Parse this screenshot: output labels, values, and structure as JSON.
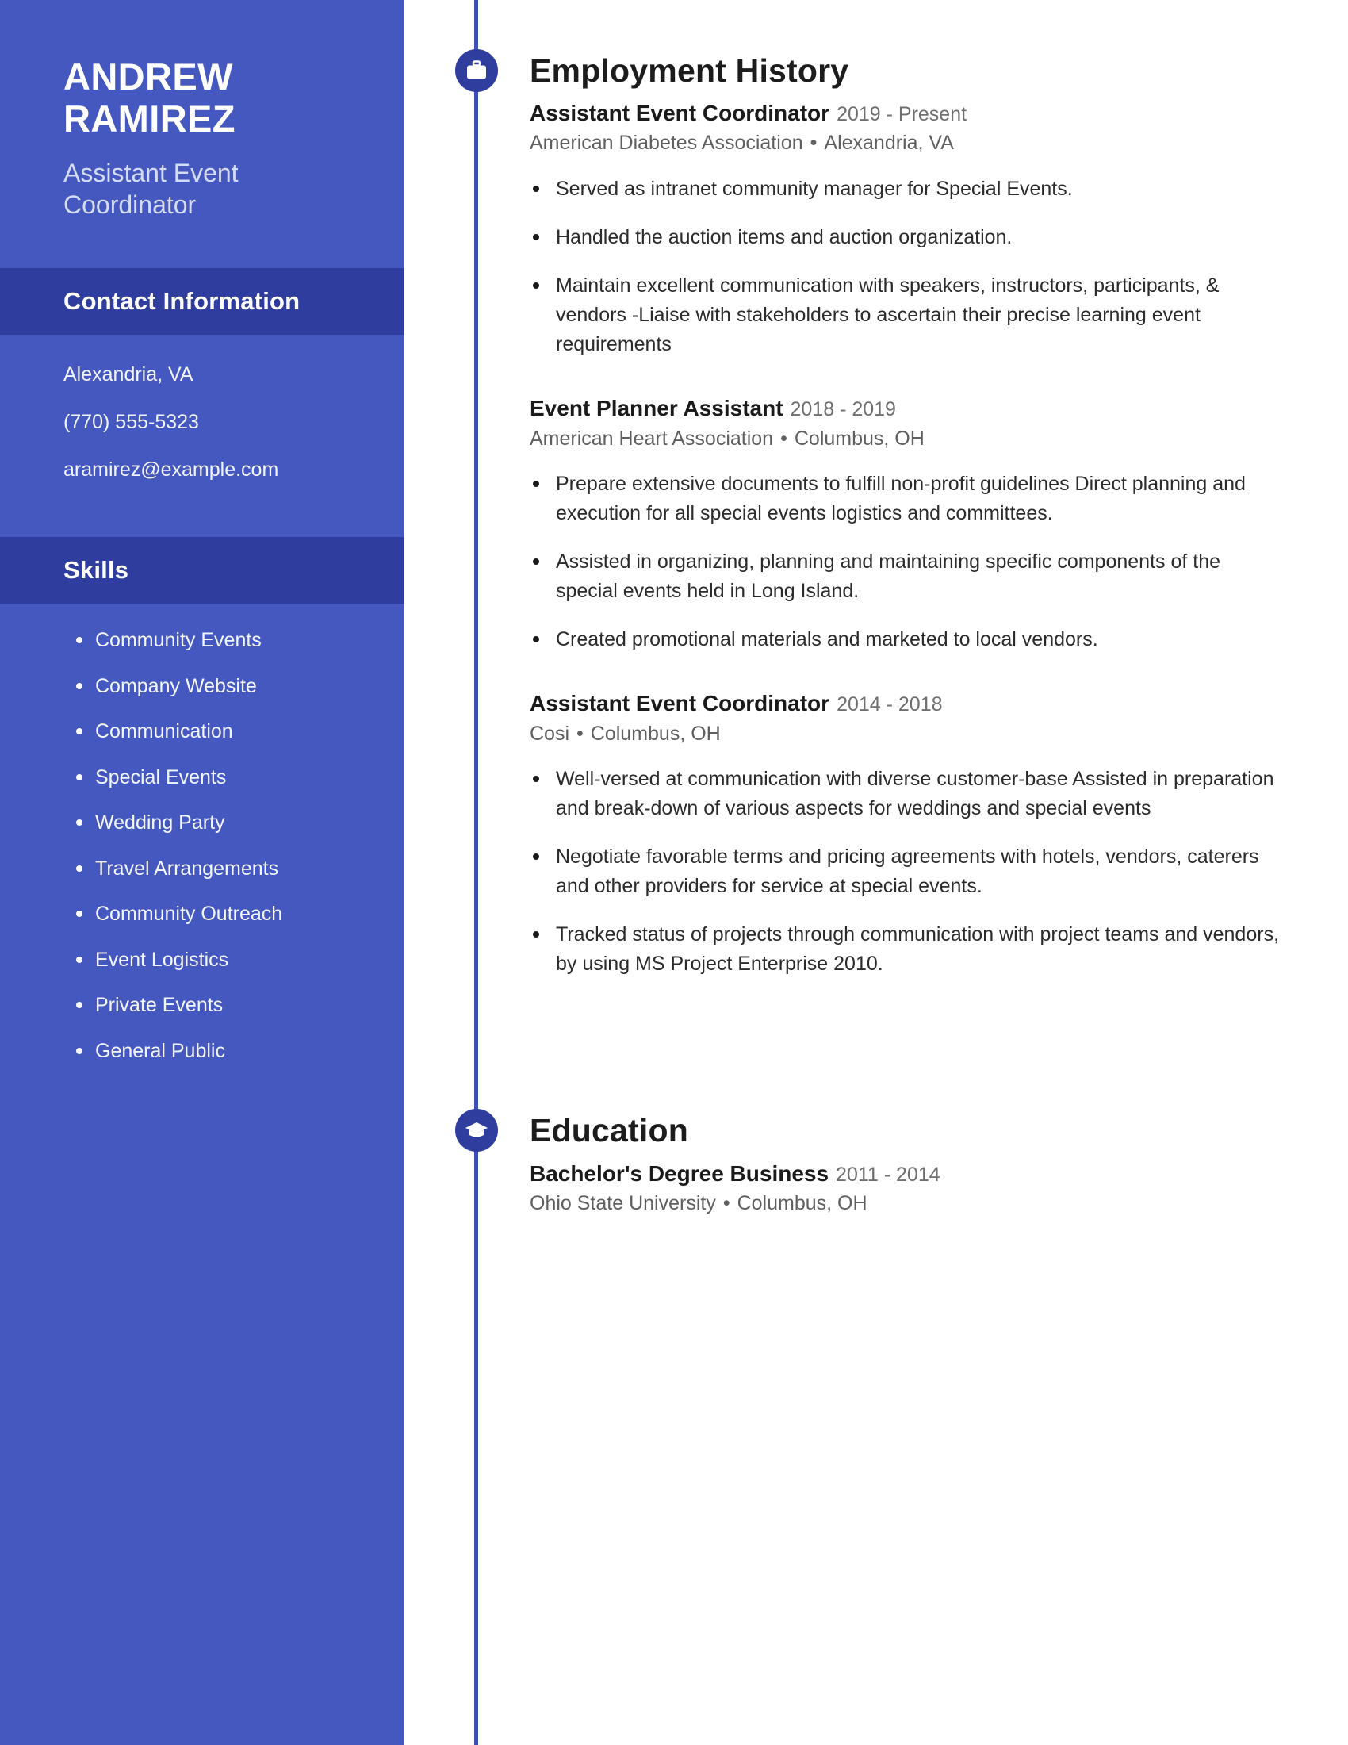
{
  "sidebar": {
    "name_first": "ANDREW",
    "name_last": "RAMIREZ",
    "role": "Assistant Event Coordinator",
    "contact": {
      "heading": "Contact Information",
      "items": [
        "Alexandria, VA",
        "(770) 555-5323",
        "aramirez@example.com"
      ]
    },
    "skills": {
      "heading": "Skills",
      "items": [
        "Community Events",
        "Company Website",
        "Communication",
        "Special Events",
        "Wedding Party",
        "Travel Arrangements",
        "Community Outreach",
        "Event Logistics",
        "Private Events",
        "General Public"
      ]
    },
    "colors": {
      "background": "#4558c0",
      "heading_band": "#2f3d9e",
      "text": "#ffffff",
      "muted_text": "#d5dbf3"
    }
  },
  "main": {
    "employment": {
      "title": "Employment History",
      "icon": "briefcase-icon",
      "entries": [
        {
          "title": "Assistant Event Coordinator",
          "dates": "2019 - Present",
          "company": "American Diabetes Association",
          "location": "Alexandria, VA",
          "duties": [
            "Served as intranet community manager for Special Events.",
            "Handled the auction items and auction organization.",
            "Maintain excellent communication with speakers, instructors, participants, & vendors -Liaise with stakeholders to ascertain their precise learning event requirements"
          ]
        },
        {
          "title": "Event Planner Assistant",
          "dates": "2018 - 2019",
          "company": "American Heart Association",
          "location": "Columbus, OH",
          "duties": [
            "Prepare extensive documents to fulfill non-profit guidelines Direct planning and execution for all special events logistics and committees.",
            "Assisted in organizing, planning and maintaining specific components of the special events held in Long Island.",
            "Created promotional materials and marketed to local vendors."
          ]
        },
        {
          "title": "Assistant Event Coordinator",
          "dates": "2014 - 2018",
          "company": "Cosi",
          "location": "Columbus, OH",
          "duties": [
            "Well-versed at communication with diverse customer-base Assisted in preparation and break-down of various aspects for weddings and special events",
            "Negotiate favorable terms and pricing agreements with hotels, vendors, caterers and other providers for service at special events.",
            "Tracked status of projects through communication with project teams and vendors, by using MS Project Enterprise 2010."
          ]
        }
      ]
    },
    "education": {
      "title": "Education",
      "icon": "graduation-cap-icon",
      "entries": [
        {
          "title": "Bachelor's Degree Business",
          "dates": "2011 - 2014",
          "school": "Ohio State University",
          "location": "Columbus, OH"
        }
      ]
    },
    "separator_dot": "•",
    "colors": {
      "timeline": "#3c4fb8",
      "icon_circle": "#2f3d9e",
      "heading_text": "#1c1c1c",
      "body_text": "#2b2b2b",
      "muted_text": "#6f6f6f"
    }
  }
}
